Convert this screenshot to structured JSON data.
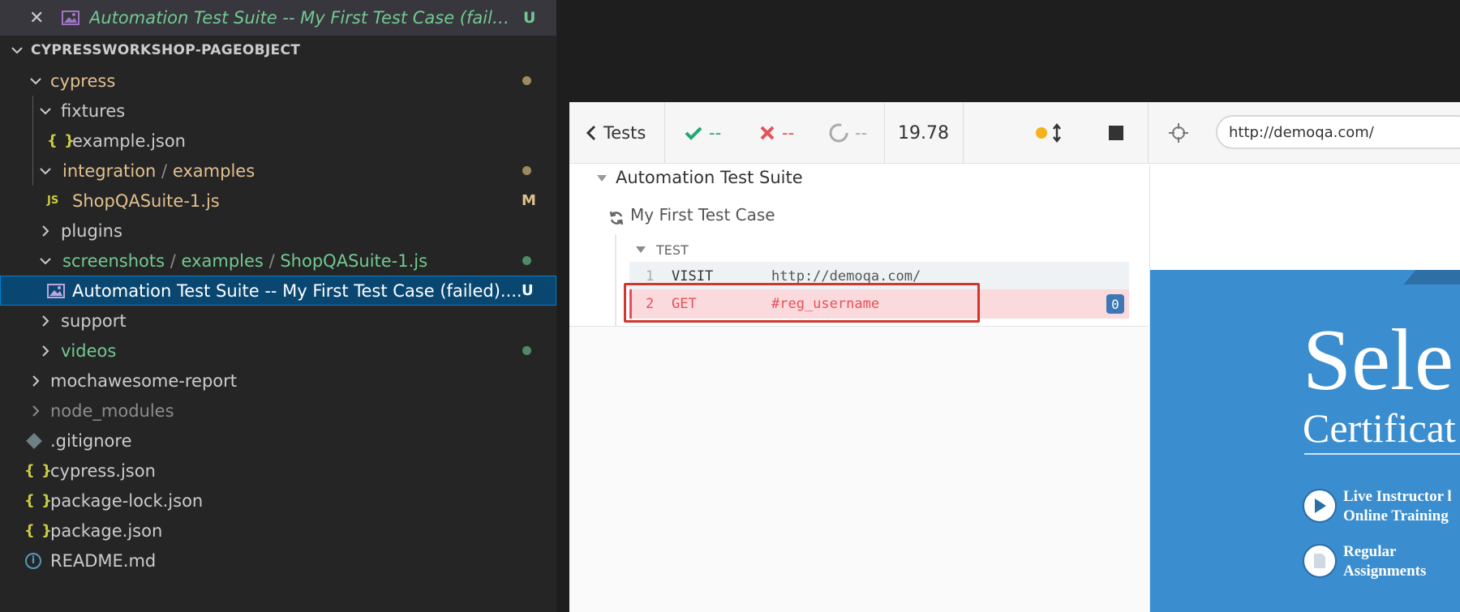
{
  "explorer": {
    "open_editor": {
      "file": "Automation Test Suite -- My First Test Case (failed)....",
      "badge": "U"
    },
    "workspace_title": "CYPRESSWORKSHOP-PAGEOBJECT",
    "tree": {
      "cypress": {
        "label": "cypress"
      },
      "fixtures": {
        "label": "fixtures"
      },
      "example_json": {
        "label": "example.json"
      },
      "integration": {
        "label": "integration",
        "sep": "/",
        "sub": "examples"
      },
      "shopqa": {
        "label": "ShopQASuite-1.js",
        "badge": "M"
      },
      "plugins": {
        "label": "plugins"
      },
      "screenshots": {
        "label": "screenshots",
        "sep1": "/",
        "sub1": "examples",
        "sep2": "/",
        "sub2": "ShopQASuite-1.js"
      },
      "screenshot_file": {
        "label": "Automation Test Suite -- My First Test Case (failed)....",
        "badge": "U"
      },
      "support": {
        "label": "support"
      },
      "videos": {
        "label": "videos"
      },
      "mochawesome": {
        "label": "mochawesome-report"
      },
      "node_modules": {
        "label": "node_modules"
      },
      "gitignore": {
        "label": ".gitignore"
      },
      "cypress_json": {
        "label": "cypress.json"
      },
      "package_lock": {
        "label": "package-lock.json"
      },
      "package_json": {
        "label": "package.json"
      },
      "readme": {
        "label": "README.md"
      }
    },
    "icons": {
      "json": "{ }",
      "js": "JS",
      "info": "i"
    },
    "colors": {
      "untracked": "#73c991",
      "modified": "#e2c08d",
      "ignored": "#8c8c8c",
      "selected": "#094771"
    }
  },
  "runner": {
    "tests_label": "Tests",
    "passed": "--",
    "failed": "--",
    "pending": "--",
    "duration": "19.78",
    "url": "http://demoqa.com/",
    "suite_title": "Automation Test Suite",
    "test_title": "My First Test Case",
    "section_label": "TEST",
    "commands": [
      {
        "num": "1",
        "name": "VISIT",
        "message": "http://demoqa.com/"
      },
      {
        "num": "2",
        "name": "GET",
        "message": "#reg_username",
        "count": "0"
      }
    ],
    "app": {
      "headline": "Sele",
      "subheadline": "Certificat",
      "feature1_line1": "Live Instructor l",
      "feature1_line2": "Online Training",
      "feature2_line1": "Regular",
      "feature2_line2": "Assignments"
    },
    "colors": {
      "fail": "#e94f5a",
      "fail_bg": "#fadadd",
      "pass": "#1fa971",
      "banner": "#3a8dce"
    }
  }
}
